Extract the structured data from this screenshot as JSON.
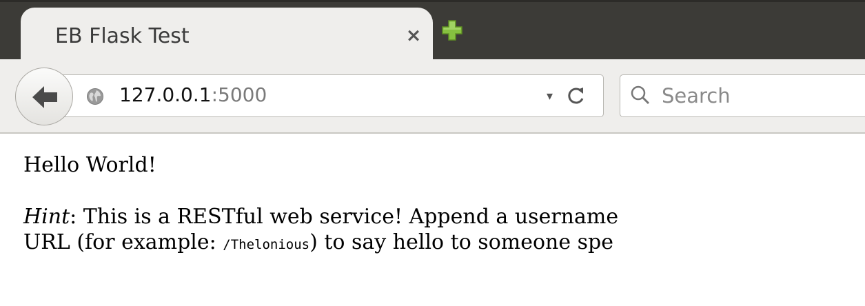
{
  "tab": {
    "title": "EB Flask Test",
    "close_glyph": "×"
  },
  "navbar": {
    "url_host": "127.0.0.1",
    "url_port": ":5000",
    "dropmarker_glyph": "▾",
    "search_placeholder": "Search"
  },
  "page": {
    "greeting": "Hello World!",
    "hint_label": "Hint",
    "hint_line1_rest": ": This is a RESTful web service! Append a username",
    "hint_line2_pre": "URL (for example: ",
    "hint_example": "/Thelonious",
    "hint_line2_post": ") to say hello to someone spe"
  },
  "icons": {
    "back": "back-arrow-icon",
    "globe": "globe-icon",
    "reload": "reload-icon",
    "search": "search-icon",
    "new_tab": "plus-icon"
  },
  "colors": {
    "tabstrip_bg": "#3c3b37",
    "toolbar_bg": "#efeeec",
    "new_tab_green": "#8bc34a"
  }
}
